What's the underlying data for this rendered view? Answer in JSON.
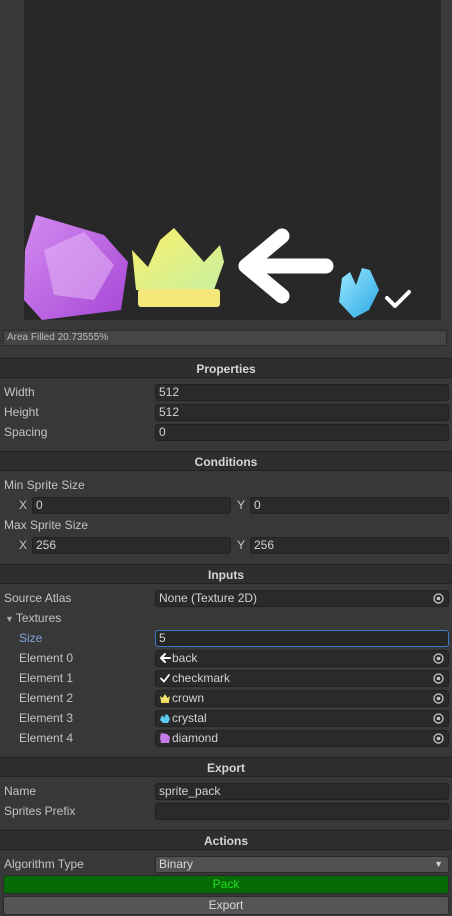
{
  "preview": {
    "sprites": [
      "diamond-sprite",
      "crown-sprite",
      "back-sprite",
      "crystal-sprite",
      "checkmark-sprite"
    ],
    "area_filled": "Area Filled 20.73555%"
  },
  "properties": {
    "header": "Properties",
    "width_label": "Width",
    "width_value": "512",
    "height_label": "Height",
    "height_value": "512",
    "spacing_label": "Spacing",
    "spacing_value": "0"
  },
  "conditions": {
    "header": "Conditions",
    "min_label": "Min Sprite Size",
    "min_x_label": "X",
    "min_x": "0",
    "min_y_label": "Y",
    "min_y": "0",
    "max_label": "Max Sprite Size",
    "max_x_label": "X",
    "max_x": "256",
    "max_y_label": "Y",
    "max_y": "256"
  },
  "inputs": {
    "header": "Inputs",
    "source_atlas_label": "Source Atlas",
    "source_atlas_value": "None (Texture 2D)",
    "textures_label": "Textures",
    "size_label": "Size",
    "size_value": "5",
    "elements": [
      {
        "label": "Element 0",
        "value": "back",
        "icon": "arrow-left-icon"
      },
      {
        "label": "Element 1",
        "value": "checkmark",
        "icon": "checkmark-icon"
      },
      {
        "label": "Element 2",
        "value": "crown",
        "icon": "crown-icon"
      },
      {
        "label": "Element 3",
        "value": "crystal",
        "icon": "crystal-icon"
      },
      {
        "label": "Element 4",
        "value": "diamond",
        "icon": "diamond-icon"
      }
    ]
  },
  "export": {
    "header": "Export",
    "name_label": "Name",
    "name_value": "sprite_pack",
    "prefix_label": "Sprites Prefix",
    "prefix_value": ""
  },
  "actions": {
    "header": "Actions",
    "algorithm_label": "Algorithm Type",
    "algorithm_value": "Binary",
    "pack_label": "Pack",
    "export_label": "Export"
  },
  "colors": {
    "pack_bg": "#066b06",
    "pack_text": "#1fe41f",
    "focus_border": "#3d79c6"
  }
}
